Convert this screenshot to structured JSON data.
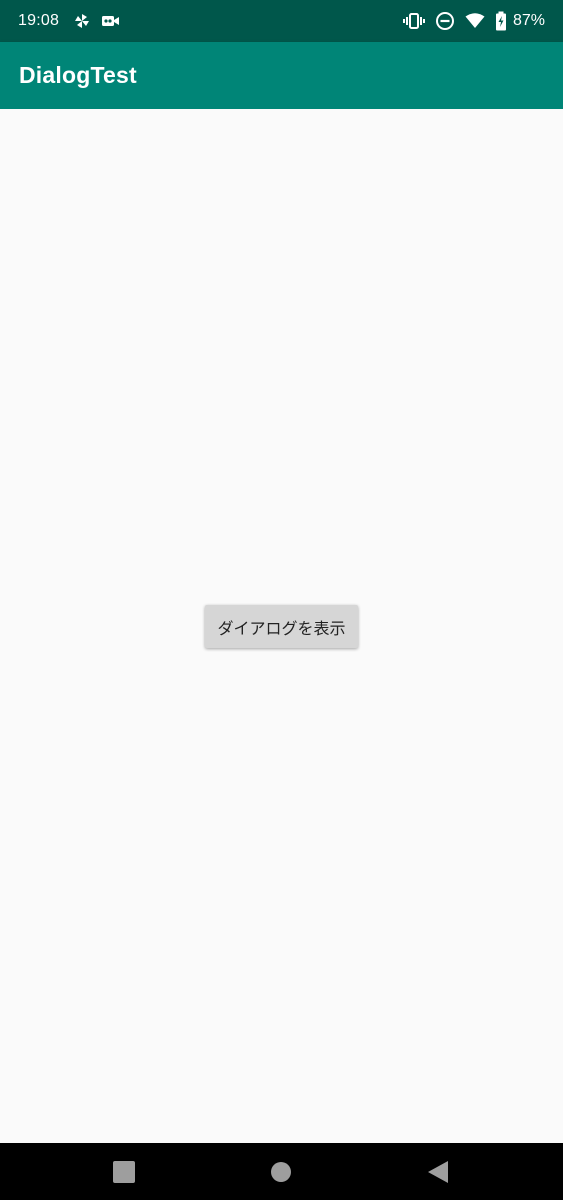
{
  "status_bar": {
    "time": "19:08",
    "battery_percent": "87%",
    "left_icons": [
      "pinwheel-icon",
      "video-camera-icon"
    ],
    "right_icons": [
      "vibrate-icon",
      "do-not-disturb-icon",
      "wifi-icon",
      "battery-charging-icon"
    ],
    "background_color": "#00574b"
  },
  "app_bar": {
    "title": "DialogTest",
    "background_color": "#008577"
  },
  "main": {
    "show_dialog_button_label": "ダイアログを表示",
    "button_color": "#d6d6d6"
  },
  "nav_bar": {
    "buttons": [
      "recents-icon",
      "home-icon",
      "back-icon"
    ],
    "background_color": "#000000"
  }
}
